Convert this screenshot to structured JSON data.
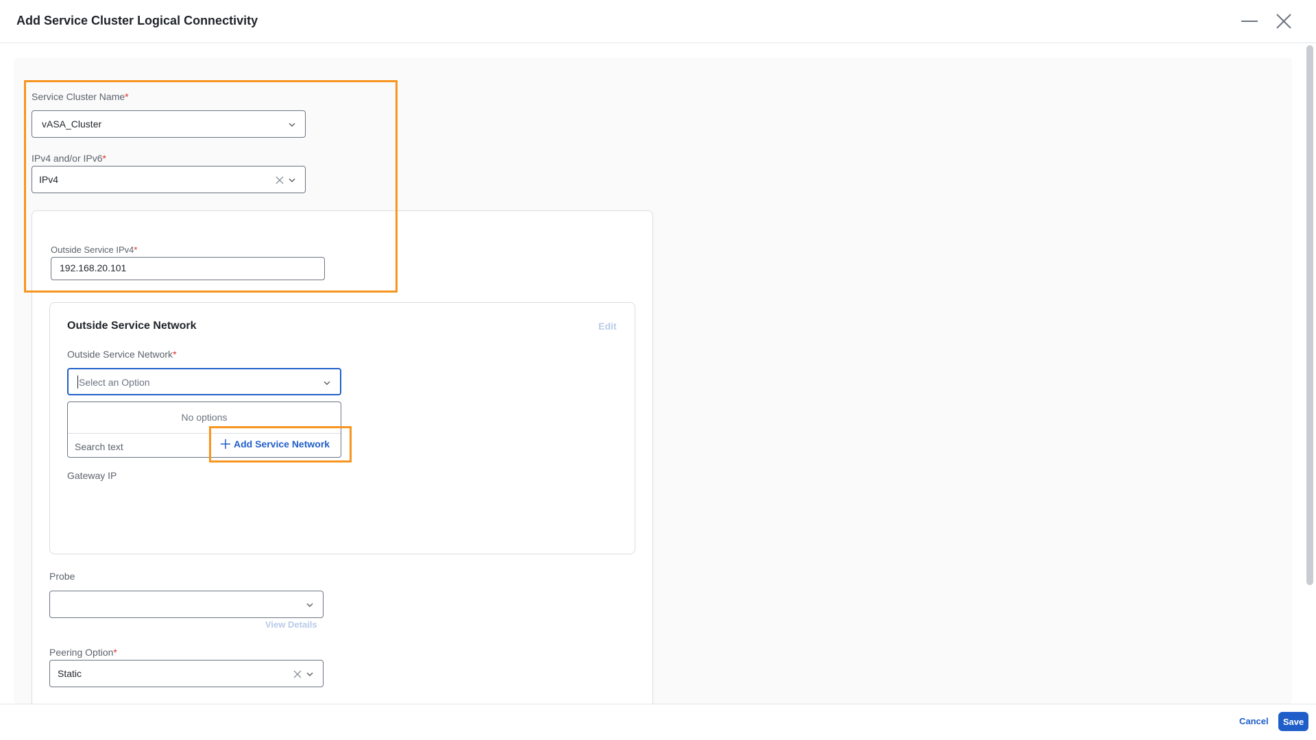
{
  "header": {
    "title": "Add Service Cluster Logical Connectivity"
  },
  "form": {
    "service_cluster_name": {
      "label": "Service Cluster Name",
      "required_mark": "*",
      "value": "vASA_Cluster"
    },
    "ip_version": {
      "label": "IPv4 and/or IPv6",
      "required_mark": "*",
      "value": "IPv4"
    },
    "outside_service_ipv4": {
      "label": "Outside Service IPv4",
      "required_mark": "*",
      "value": "192.168.20.101"
    },
    "outside_service_network_section": {
      "title": "Outside Service Network",
      "edit_label": "Edit",
      "network_field": {
        "label": "Outside Service Network",
        "required_mark": "*",
        "placeholder": "Select an Option"
      },
      "dropdown": {
        "no_options": "No options",
        "search_placeholder": "Search text",
        "add_label": "Add Service Network"
      },
      "gateway_label": "Gateway IP"
    },
    "probe": {
      "label": "Probe",
      "value": "",
      "view_details": "View Details"
    },
    "peering_option": {
      "label": "Peering Option",
      "required_mark": "*",
      "value": "Static"
    }
  },
  "footer": {
    "cancel_label": "Cancel",
    "save_label": "Save"
  },
  "colors": {
    "highlight": "#f7941d",
    "accent": "#1f5ec9",
    "required": "#e02b2b"
  }
}
